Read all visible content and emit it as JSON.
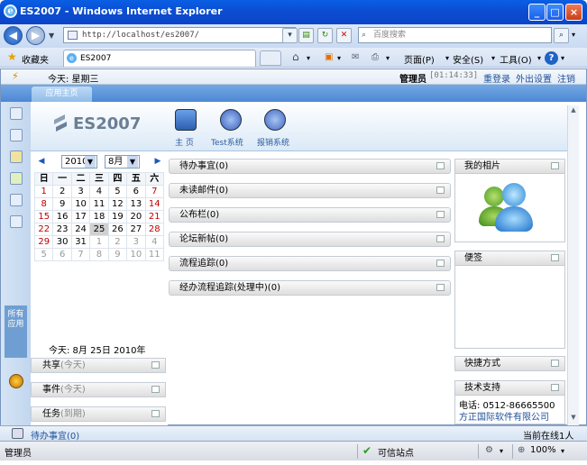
{
  "window": {
    "title": "ES2007 - Windows Internet Explorer",
    "min": "_",
    "max": "□",
    "close": "×"
  },
  "nav": {
    "back": "◀",
    "forward": "▶",
    "address": "http://localhost/es2007/",
    "search_placeholder": "百度搜索"
  },
  "toolbar": {
    "favorites": "收藏夹",
    "tab_title": "ES2007",
    "page": "页面(P)",
    "safety": "安全(S)",
    "tools": "工具(O)",
    "help": "?"
  },
  "app": {
    "today": "今天: 星期三",
    "user": "管理员",
    "time": "[01:14:33]",
    "relogin": "重登录",
    "away": "外出设置",
    "logout": "注销",
    "tab_home": "应用主页",
    "logo": "ES2007",
    "systems": [
      {
        "label": "主 页",
        "color": "#2c5fb0"
      },
      {
        "label": "Test系统",
        "color": "#4a6ec6"
      },
      {
        "label": "报销系统",
        "color": "#5074c8"
      }
    ],
    "all_apps": "所有应用"
  },
  "calendar": {
    "year": "2010",
    "month": "8月",
    "weekdays": [
      "日",
      "一",
      "二",
      "三",
      "四",
      "五",
      "六"
    ],
    "weeks": [
      [
        "1",
        "2",
        "3",
        "4",
        "5",
        "6",
        "7"
      ],
      [
        "8",
        "9",
        "10",
        "11",
        "12",
        "13",
        "14"
      ],
      [
        "15",
        "16",
        "17",
        "18",
        "19",
        "20",
        "21"
      ],
      [
        "22",
        "23",
        "24",
        "25",
        "26",
        "27",
        "28"
      ],
      [
        "29",
        "30",
        "31",
        "1",
        "2",
        "3",
        "4"
      ],
      [
        "5",
        "6",
        "7",
        "8",
        "9",
        "10",
        "11"
      ]
    ],
    "today_label": "今天: 8月 25日 2010年"
  },
  "side_sections": [
    {
      "name": "共享",
      "sub": "(今天)"
    },
    {
      "name": "事件",
      "sub": "(今天)"
    },
    {
      "name": "任务",
      "sub": "(到期)"
    }
  ],
  "center_boxes": [
    "待办事宜(0)",
    "未读邮件(0)",
    "公布栏(0)",
    "论坛新帖(0)",
    "流程追踪(0)",
    "经办流程追踪(处理中)(0)"
  ],
  "right": {
    "photo": "我的相片",
    "notes": "便签",
    "shortcuts": "快捷方式",
    "support": "技术支持",
    "phone": "电话: 0512-86665500",
    "company": "方正国际软件有限公司"
  },
  "bottom": {
    "todo": "待办事宜(0)",
    "online": "当前在线1人"
  },
  "status": {
    "user": "管理员",
    "zone": "可信站点",
    "zoom": "100%"
  }
}
